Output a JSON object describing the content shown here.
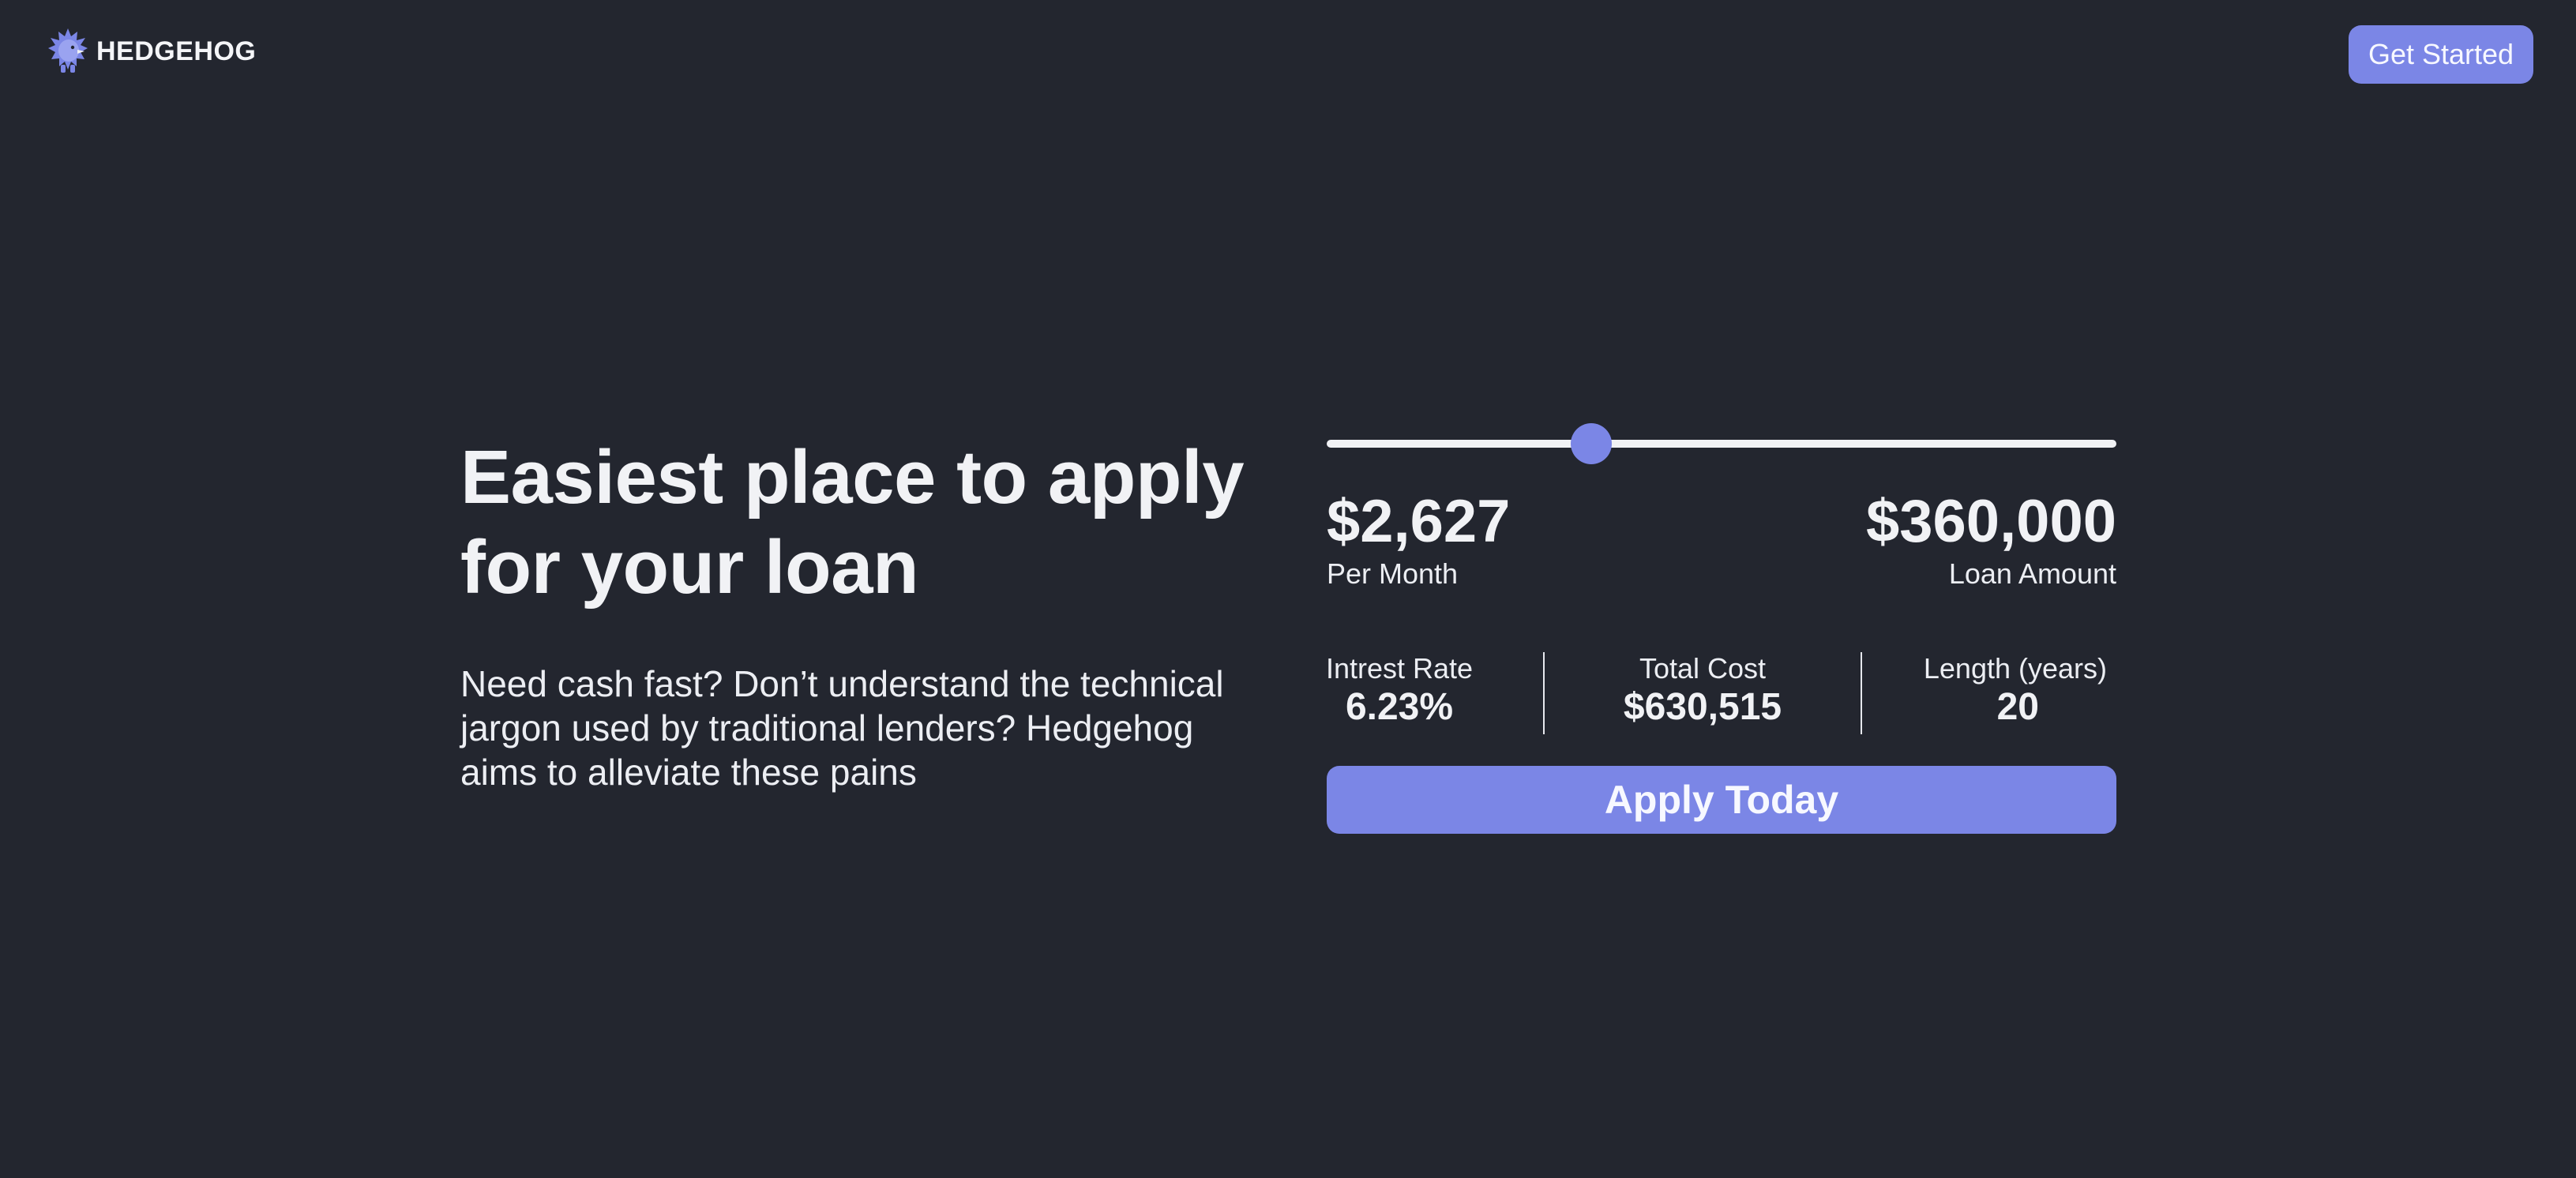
{
  "header": {
    "brand_name": "HEDGEHOG",
    "logo_icon": "hedgehog-icon",
    "cta_label": "Get Started"
  },
  "hero": {
    "title_line1": "Easiest place to apply",
    "title_line2": "for your loan",
    "description": "Need cash fast? Don’t understand the technical jargon used by traditional lenders? Hedgehog aims to alleviate these pains"
  },
  "calculator": {
    "slider_fraction": 0.335,
    "monthly_payment": "$2,627",
    "monthly_label": "Per Month",
    "loan_amount": "$360,000",
    "loan_amount_label": "Loan Amount",
    "stats": {
      "interest_label": "Intrest Rate",
      "interest_value": "6.23%",
      "total_label": "Total Cost",
      "total_value": "$630,515",
      "length_label": "Length (years)",
      "length_value": "20"
    },
    "apply_label": "Apply Today"
  },
  "colors": {
    "background": "#23262f",
    "accent": "#7b86e6",
    "text": "#f1f2f5"
  }
}
